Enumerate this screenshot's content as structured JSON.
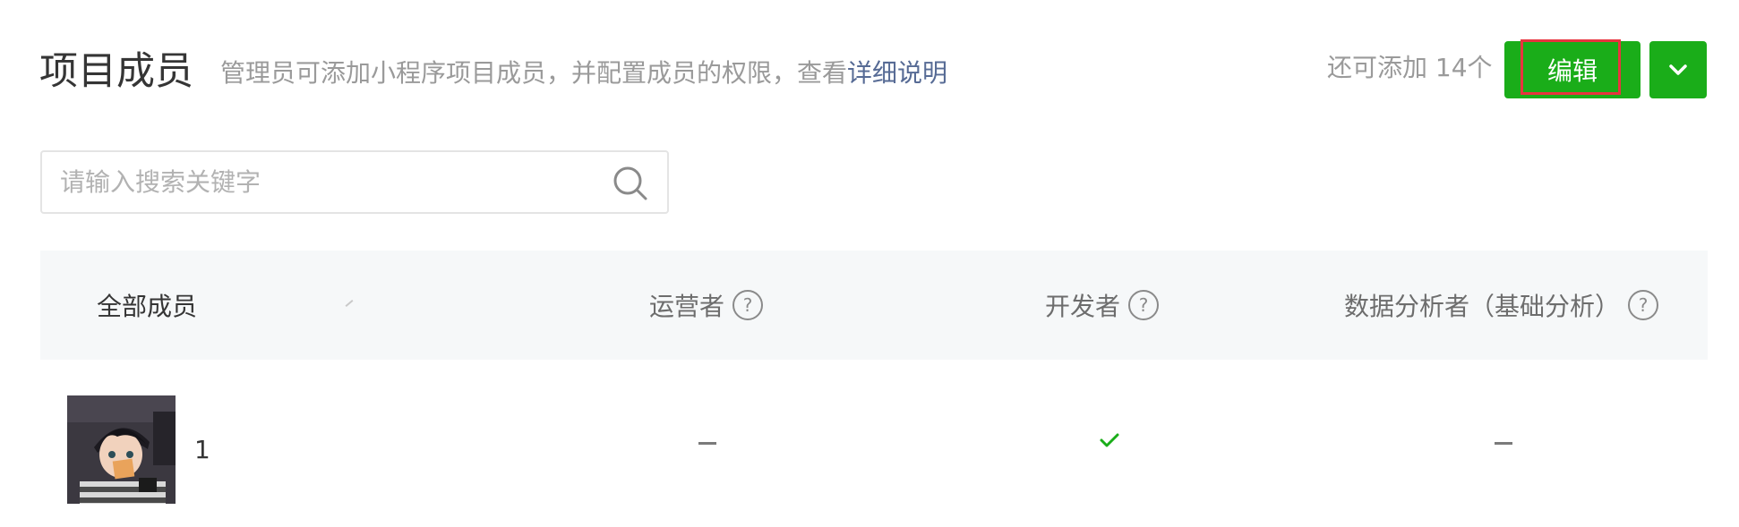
{
  "header": {
    "title": "项目成员",
    "description_prefix": "管理员可添加小程序项目成员，并配置成员的权限，查看",
    "description_link": "详细说明",
    "quota_text": "还可添加 14个",
    "edit_label": "编辑"
  },
  "search": {
    "placeholder": "请输入搜索关键字",
    "value": ""
  },
  "table": {
    "columns": [
      "全部成员",
      "运营者",
      "开发者",
      "数据分析者（基础分析）"
    ],
    "rows": [
      {
        "name": "1",
        "operator": "–",
        "developer": "✓",
        "data_analyst": "–"
      }
    ]
  },
  "colors": {
    "primary": "#1aad19",
    "link": "#576b95",
    "highlight_frame": "#e8343f",
    "header_bg": "#f6f8f9"
  }
}
